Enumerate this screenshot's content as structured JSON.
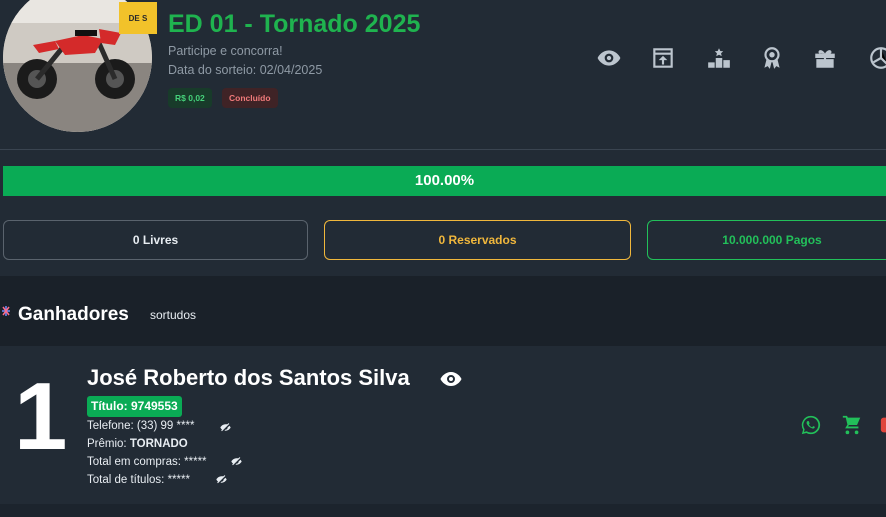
{
  "raffle": {
    "ribbon": "DE S",
    "title": "ED 01 - Tornado 2025",
    "subtitle": "Participe e concorra!",
    "draw_date": "Data do sorteio: 02/04/2025",
    "price_badge": "R$ 0,02",
    "status_badge": "Concluído"
  },
  "toolbar": {
    "icons": [
      "eye-icon",
      "share-icon",
      "podium-icon",
      "award-icon",
      "gift-icon",
      "spinner-icon"
    ]
  },
  "progress": {
    "value": 100,
    "label": "100.00%"
  },
  "stats": {
    "free": "0 Livres",
    "reserved": "0 Reservados",
    "paid": "10.000.000 Pagos"
  },
  "winners": {
    "title": "Ganhadores",
    "subtitle": "sortudos",
    "items": [
      {
        "rank": "1",
        "name": "José Roberto dos Santos Silva",
        "ticket": "Título: 9749553",
        "phone_label": "Telefone:",
        "phone_value": "(33) 99 ****",
        "prize_label": "Prêmio:",
        "prize_value": "TORNADO",
        "purchases_label": "Total em compras:",
        "purchases_value": "*****",
        "titles_label": "Total de títulos:",
        "titles_value": "*****"
      }
    ]
  },
  "colors": {
    "accent_green": "#0aab55",
    "title_green": "#1fb34f",
    "reserved_yellow": "#f0b73c",
    "status_red": "#ef7a7a",
    "background": "#1c242d",
    "panel": "#222b35"
  }
}
